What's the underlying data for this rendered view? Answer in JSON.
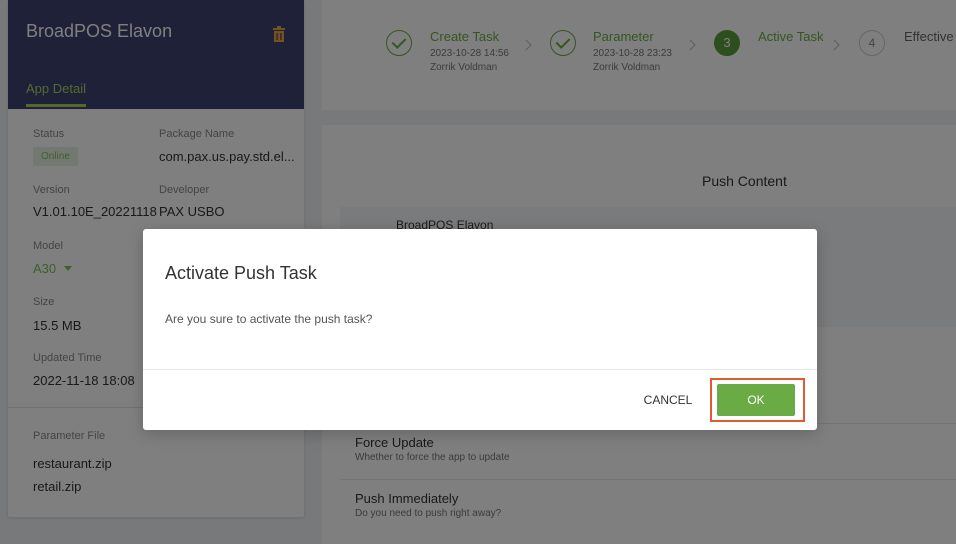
{
  "app": {
    "title": "BroadPOS Elavon",
    "tab": "App Detail"
  },
  "details": {
    "status_label": "Status",
    "status_value": "Online",
    "package_label": "Package Name",
    "package_value": "com.pax.us.pay.std.el...",
    "version_label": "Version",
    "version_value": "V1.01.10E_20221118",
    "developer_label": "Developer",
    "developer_value": "PAX USBO",
    "model_label": "Model",
    "model_value": "A30",
    "size_label": "Size",
    "size_value": "15.5 MB",
    "updated_label": "Updated Time",
    "updated_value": "2022-11-18 18:08",
    "param_label": "Parameter File",
    "param_files": [
      "restaurant.zip",
      "retail.zip"
    ]
  },
  "steps": [
    {
      "title": "Create Task",
      "date": "2023-10-28 14:56",
      "user": "Zorrik Voldman"
    },
    {
      "title": "Parameter",
      "date": "2023-10-28 23:23",
      "user": "Zorrik Voldman"
    },
    {
      "number": "3",
      "title": "Active Task"
    },
    {
      "number": "4",
      "title": "Effective"
    }
  ],
  "content": {
    "push_title": "Push Content",
    "app_row": "BroadPOS Elavon",
    "force_update_title": "Force Update",
    "force_update_desc": "Whether to force the app to update",
    "push_now_title": "Push Immediately",
    "push_now_desc": "Do you need to push right away?"
  },
  "modal": {
    "title": "Activate Push Task",
    "message": "Are you sure to activate the push task?",
    "cancel": "CANCEL",
    "ok": "OK"
  },
  "colors": {
    "header_bg": "#3e4372",
    "accent_green": "#6aab45",
    "highlight_red": "#e05b2e"
  }
}
